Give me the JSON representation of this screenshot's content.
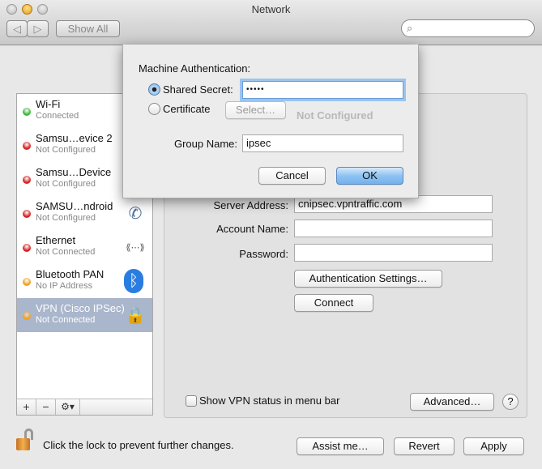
{
  "window": {
    "title": "Network",
    "show_all": "Show All",
    "search_placeholder": "",
    "search_icon": "magnifier-icon"
  },
  "background": {
    "status_ghost": "Not Configured"
  },
  "sidebar": {
    "items": [
      {
        "name": "Wi-Fi",
        "status": "Connected",
        "dot": "#3cb83c",
        "icon": "wifi-icon"
      },
      {
        "name": "Samsu…evice 2",
        "status": "Not Configured",
        "dot": "#d42020",
        "icon": "phone-icon"
      },
      {
        "name": "Samsu…Device",
        "status": "Not Configured",
        "dot": "#d42020",
        "icon": "phone-icon"
      },
      {
        "name": "SAMSU…ndroid",
        "status": "Not Configured",
        "dot": "#d42020",
        "icon": "phone-icon"
      },
      {
        "name": "Ethernet",
        "status": "Not Connected",
        "dot": "#d42020",
        "icon": "ethernet-icon"
      },
      {
        "name": "Bluetooth PAN",
        "status": "No IP Address",
        "dot": "#f0a020",
        "icon": "bluetooth-icon"
      },
      {
        "name": "VPN (Cisco IPSec)",
        "status": "Not Connected",
        "dot": "#f0a020",
        "icon": "lock-icon",
        "selected": true
      }
    ],
    "add": "+",
    "remove": "−",
    "gear": "⚙▾"
  },
  "panel": {
    "server_address_label": "Server Address:",
    "server_address": "cnipsec.vpntraffic.com",
    "account_name_label": "Account Name:",
    "account_name": "",
    "password_label": "Password:",
    "password": "",
    "auth_settings": "Authentication Settings…",
    "connect": "Connect",
    "show_vpn_status": "Show VPN status in menu bar",
    "show_vpn_checked": false,
    "advanced": "Advanced…",
    "help": "?"
  },
  "footer": {
    "lock_text": "Click the lock to prevent further changes.",
    "assist": "Assist me…",
    "revert": "Revert",
    "apply": "Apply"
  },
  "sheet": {
    "heading": "Machine Authentication:",
    "shared_secret_label": "Shared Secret:",
    "shared_secret_value": "•••••",
    "shared_secret_selected": true,
    "certificate_label": "Certificate",
    "select": "Select…",
    "group_name_label": "Group Name:",
    "group_name": "ipsec",
    "cancel": "Cancel",
    "ok": "OK"
  }
}
